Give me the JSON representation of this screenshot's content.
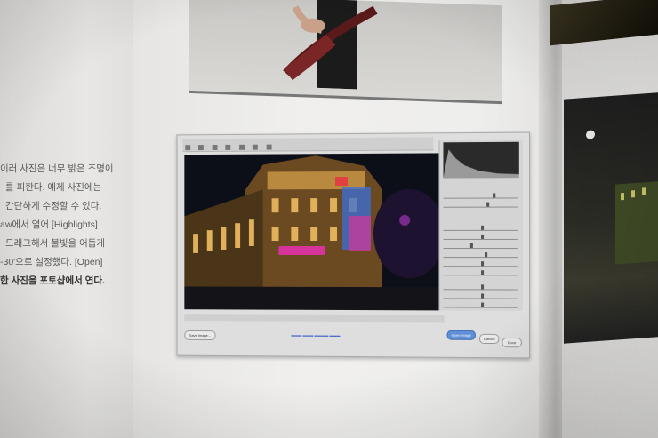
{
  "left_page": {
    "lines": [
      "이러 사진은 너무 밝은 조명이",
      "를 피한다. 예제 사진에는",
      "간단하게 수정할 수 있다.",
      "aw에서 열어 [Highlights]",
      "드래그해서 불빛을 어둡게",
      "-30'으로 설정했다. [Open]",
      "한 사진을 포토샵에서 연다."
    ]
  },
  "screenshot": {
    "buttons": {
      "save": "Save Image...",
      "open": "Open Image",
      "cancel": "Cancel",
      "done": "Done"
    },
    "colors": {
      "night_sky": "#0d0f18",
      "building_light": "#e0b15a",
      "neon_pink": "#d6349a",
      "neon_blue": "#3b6fd8",
      "open_button": "#5f8fd6"
    }
  }
}
